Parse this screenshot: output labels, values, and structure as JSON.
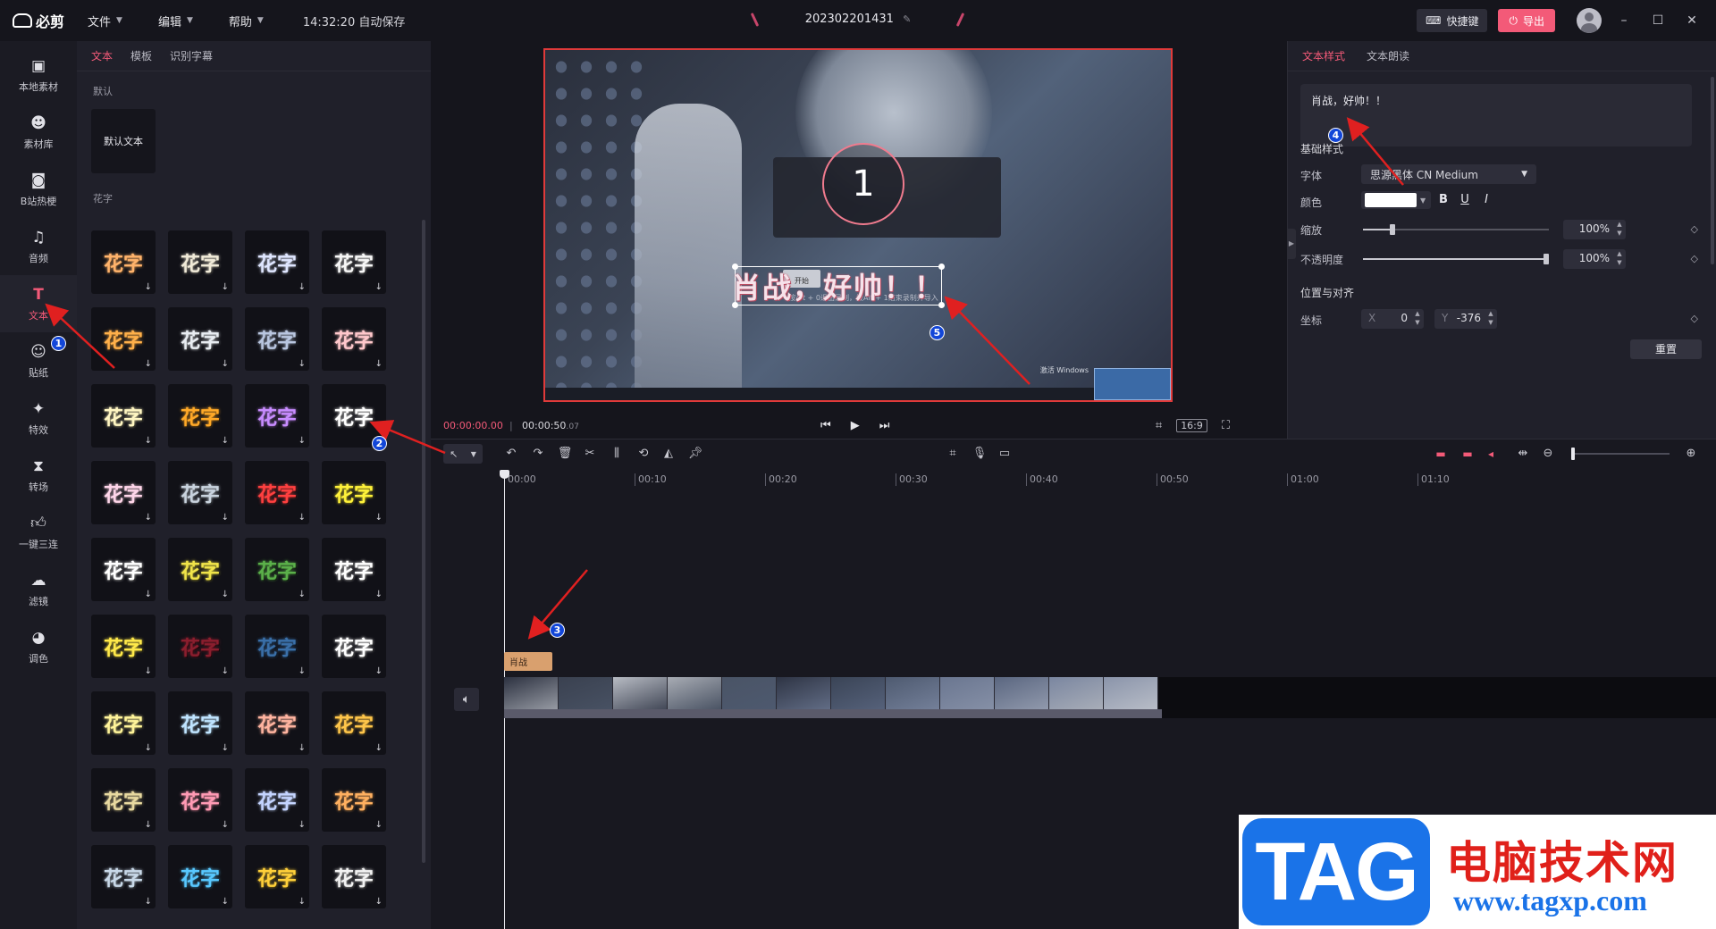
{
  "topbar": {
    "logo": "必剪",
    "menus": [
      "文件",
      "编辑",
      "帮助"
    ],
    "autosave": "14:32:20 自动保存",
    "project_name": "202302201431",
    "shortcut_label": "快捷键",
    "export_label": "导出"
  },
  "leftnav": {
    "items": [
      {
        "label": "本地素材",
        "icon": "folder-icon"
      },
      {
        "label": "素材库",
        "icon": "material-icon"
      },
      {
        "label": "B站热梗",
        "icon": "tv-icon"
      },
      {
        "label": "音频",
        "icon": "music-icon"
      },
      {
        "label": "文本",
        "icon": "text-icon"
      },
      {
        "label": "贴纸",
        "icon": "sticker-icon"
      },
      {
        "label": "特效",
        "icon": "effect-icon"
      },
      {
        "label": "转场",
        "icon": "transition-icon"
      },
      {
        "label": "一键三连",
        "icon": "like-icon"
      },
      {
        "label": "滤镜",
        "icon": "filter-icon"
      },
      {
        "label": "调色",
        "icon": "palette-icon"
      }
    ],
    "active": "文本"
  },
  "assets": {
    "tabs": [
      "文本",
      "模板",
      "识别字幕"
    ],
    "active_tab": "文本",
    "default_section": "默认",
    "default_card": "默认文本",
    "huazi_section": "花字",
    "huazi_text": "花字",
    "huazi_colors": [
      "#ffb36b",
      "#f0ead8",
      "#dfe6ff",
      "#f7f7f7",
      "#ffb04a",
      "#e9edf2",
      "#b9c6e0",
      "#ffc8cc",
      "#fff6c2",
      "#ffa928",
      "#c88cff",
      "#ffffff",
      "#ffd6ea",
      "#c9d3de",
      "#ff4040",
      "#fff23a",
      "#ffffff",
      "#f0e44a",
      "#5bb04a",
      "#ffffff",
      "#ffe94a",
      "#8a1e2e",
      "#3a6fa8",
      "#ffffff",
      "#fff49a",
      "#bfe4ff",
      "#ffb4a0",
      "#ffc64a",
      "#e8d9a0",
      "#ff9ab4",
      "#c4d4ff",
      "#ffb060",
      "#c8d8e8",
      "#58c8ff",
      "#ffd03a",
      "#f2f2f2"
    ]
  },
  "preview": {
    "countdown": "1",
    "overlay_text": "肖战，好帅！！",
    "start_label": "开始",
    "hint": "按Alt + 0退出录制，按Alt + 1结束录制并导入",
    "activate": "激活 Windows",
    "timecode_current": "00:00:00.00",
    "timecode_total": "00:00:50",
    "timecode_total_frames": ".07",
    "ratio": "16:9"
  },
  "inspector": {
    "tabs": [
      "文本样式",
      "文本朗读"
    ],
    "active_tab": "文本样式",
    "text_value": "肖战，好帅！！",
    "basic_style": "基础样式",
    "font_label": "字体",
    "font_value": "思源黑体 CN Medium",
    "color_label": "颜色",
    "color_value": "#ffffff",
    "bold": "B",
    "underline": "U",
    "italic": "I",
    "scale_label": "缩放",
    "scale_value": "100%",
    "scale_fraction": 0.16,
    "opacity_label": "不透明度",
    "opacity_value": "100%",
    "position_section": "位置与对齐",
    "coord_label": "坐标",
    "x_label": "X",
    "x_value": "0",
    "y_label": "Y",
    "y_value": "-376",
    "reset_label": "重置"
  },
  "timeline": {
    "ticks": [
      "00:00",
      "00:10",
      "00:20",
      "00:30",
      "00:40",
      "00:50",
      "01:00",
      "01:10"
    ],
    "text_clip": "肖战"
  },
  "annotations": [
    "1",
    "2",
    "3",
    "4",
    "5"
  ],
  "watermark": {
    "tag": "TAG",
    "cn": "电脑技术网",
    "url": "www.tagxp.com"
  }
}
